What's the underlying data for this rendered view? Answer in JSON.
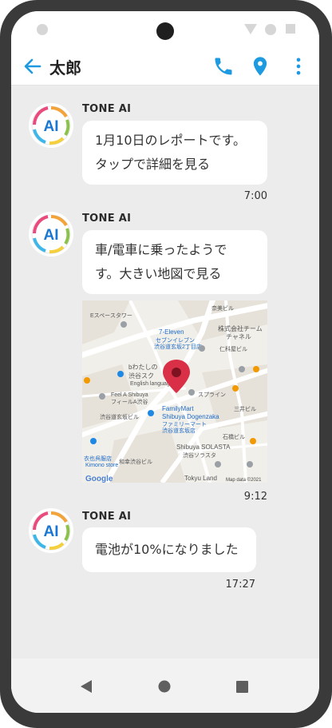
{
  "header": {
    "back_icon": "arrow-left-icon",
    "title": "太郎",
    "actions": [
      "phone-icon",
      "location-pin-icon",
      "more-vertical-icon"
    ]
  },
  "colors": {
    "accent": "#1e9ae0",
    "pin": "#d93047",
    "background": "#ececec"
  },
  "messages": [
    {
      "sender": "TONE AI",
      "avatar_text": "AI",
      "lines": [
        "1月10日のレポートです。",
        "タップで詳細を見る"
      ],
      "time": "7:00"
    },
    {
      "sender": "TONE AI",
      "avatar_text": "AI",
      "lines": [
        "車/電車に乗ったようで",
        "す。大きい地図で見る"
      ],
      "map": {
        "labels": [
          "奈美ビル",
          "Eスペースタワー",
          "7-Eleven",
          "セブンイレブン",
          "渋谷道玄坂2丁目店",
          "株式会社チーム",
          "チャネル",
          "仁科屋ビル",
          "bわたしの",
          "渋谷スク",
          "English language",
          "スプライン",
          "Feel A Shibuya",
          "フィールA渋谷",
          "渋谷道玄坂ビル",
          "三井ビル",
          "FamilyMart",
          "Shibuya Dogenzaka",
          "ファミリーマート",
          "渋谷道玄坂店",
          "石橋ビル",
          "衣也呉服店",
          "Kimono store",
          "和幸渋谷ビル",
          "Shibuya SOLASTA",
          "渋谷ソラスタ",
          "Tokyu Land",
          "Google",
          "Map data ©2021"
        ]
      },
      "time": "9:12"
    },
    {
      "sender": "TONE AI",
      "avatar_text": "AI",
      "lines": [
        "電池が10%になりました"
      ],
      "time": "17:27"
    }
  ],
  "navbar": {
    "items": [
      "back-triangle-icon",
      "home-circle-icon",
      "recents-square-icon"
    ]
  }
}
